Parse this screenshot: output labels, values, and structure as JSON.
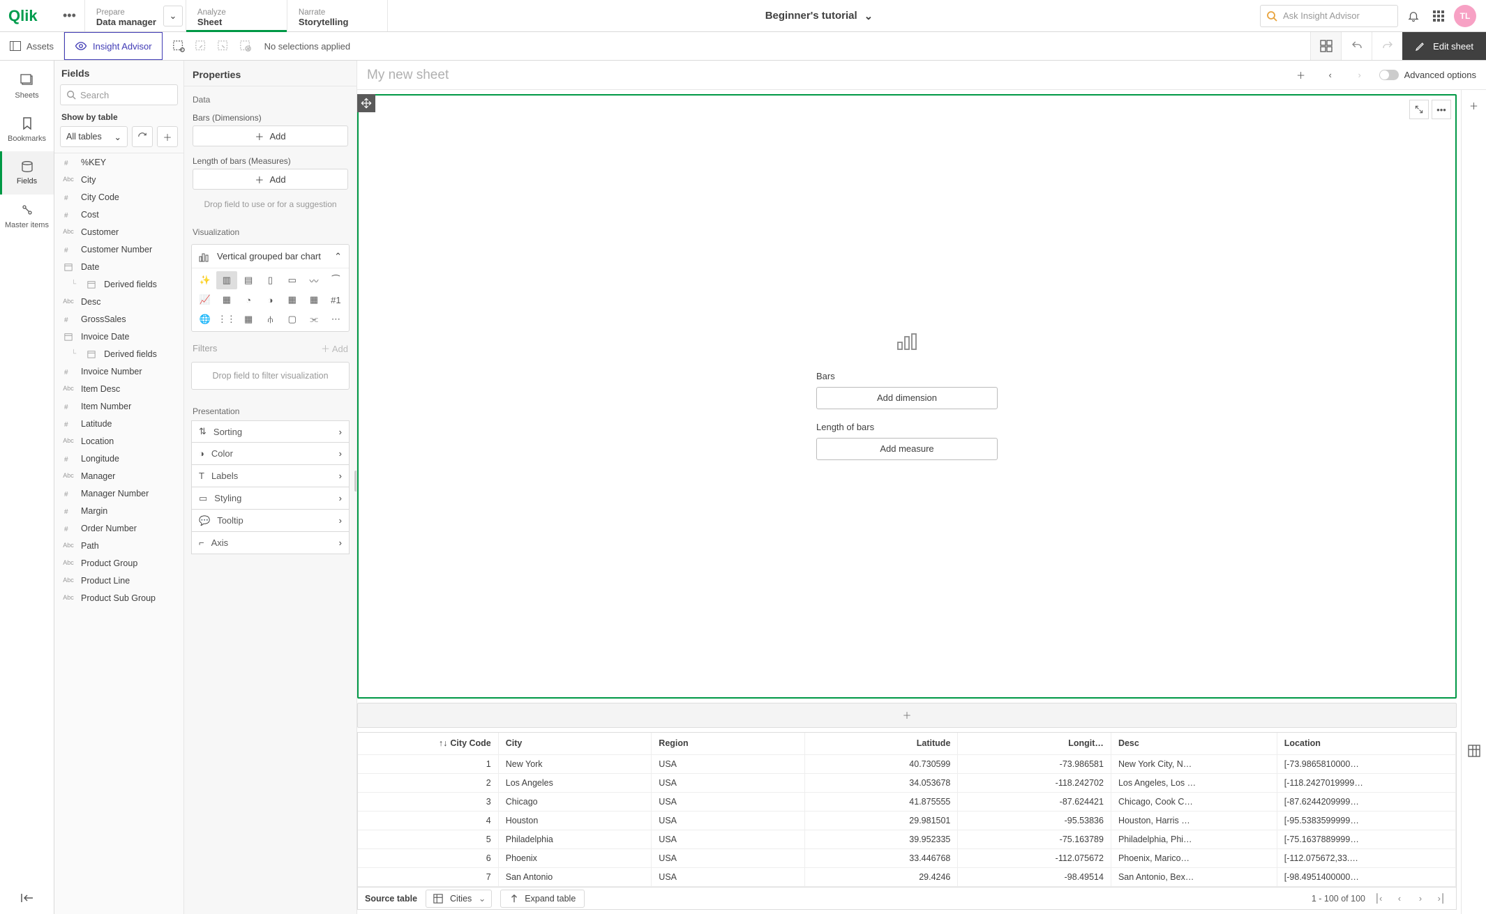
{
  "topbar": {
    "nav": [
      {
        "top": "Prepare",
        "bot": "Data manager",
        "dd": true
      },
      {
        "top": "Analyze",
        "bot": "Sheet",
        "active": true
      },
      {
        "top": "Narrate",
        "bot": "Storytelling"
      }
    ],
    "app_title": "Beginner's tutorial",
    "search_placeholder": "Ask Insight Advisor",
    "avatar": "TL"
  },
  "toolbar": {
    "assets": "Assets",
    "insight": "Insight Advisor",
    "no_sel": "No selections applied",
    "edit": "Edit sheet"
  },
  "rail": [
    {
      "id": "sheets",
      "label": "Sheets"
    },
    {
      "id": "bookmarks",
      "label": "Bookmarks"
    },
    {
      "id": "fields",
      "label": "Fields",
      "active": true
    },
    {
      "id": "master",
      "label": "Master items"
    }
  ],
  "fields_panel": {
    "title": "Fields",
    "search_ph": "Search",
    "show_by": "Show by table",
    "dd": "All tables",
    "items": [
      {
        "t": "num",
        "n": "%KEY"
      },
      {
        "t": "abc",
        "n": "City"
      },
      {
        "t": "num",
        "n": "City Code"
      },
      {
        "t": "num",
        "n": "Cost"
      },
      {
        "t": "abc",
        "n": "Customer"
      },
      {
        "t": "num",
        "n": "Customer Number"
      },
      {
        "t": "date",
        "n": "Date"
      },
      {
        "t": "der",
        "n": "Derived fields",
        "indent": true
      },
      {
        "t": "abc",
        "n": "Desc"
      },
      {
        "t": "num",
        "n": "GrossSales"
      },
      {
        "t": "date",
        "n": "Invoice Date"
      },
      {
        "t": "der",
        "n": "Derived fields",
        "indent": true
      },
      {
        "t": "num",
        "n": "Invoice Number"
      },
      {
        "t": "abc",
        "n": "Item Desc"
      },
      {
        "t": "num",
        "n": "Item Number"
      },
      {
        "t": "num",
        "n": "Latitude"
      },
      {
        "t": "abc",
        "n": "Location"
      },
      {
        "t": "num",
        "n": "Longitude"
      },
      {
        "t": "abc",
        "n": "Manager"
      },
      {
        "t": "num",
        "n": "Manager Number"
      },
      {
        "t": "num",
        "n": "Margin"
      },
      {
        "t": "num",
        "n": "Order Number"
      },
      {
        "t": "abc",
        "n": "Path"
      },
      {
        "t": "abc",
        "n": "Product Group"
      },
      {
        "t": "abc",
        "n": "Product Line"
      },
      {
        "t": "abc",
        "n": "Product Sub Group"
      }
    ]
  },
  "props": {
    "title": "Properties",
    "data": "Data",
    "bars": "Bars (Dimensions)",
    "length": "Length of bars (Measures)",
    "add": "Add",
    "drop": "Drop field to use or for a suggestion",
    "viz": "Visualization",
    "viz_sel": "Vertical grouped bar chart",
    "filters": "Filters",
    "filters_add": "Add",
    "filter_drop": "Drop field to filter visualization",
    "presentation": "Presentation",
    "pres_items": [
      "Sorting",
      "Color",
      "Labels",
      "Styling",
      "Tooltip",
      "Axis"
    ]
  },
  "canvas": {
    "sheet_title": "My new sheet",
    "adv": "Advanced options",
    "placeholder": {
      "bars": "Bars",
      "bars_btn": "Add dimension",
      "len": "Length of bars",
      "len_btn": "Add measure"
    }
  },
  "table": {
    "cols": [
      "City Code",
      "City",
      "Region",
      "Latitude",
      "Longit…",
      "Desc",
      "Location"
    ],
    "rows": [
      [
        "1",
        "New York",
        "USA",
        "40.730599",
        "-73.986581",
        "New York City, N…",
        "[-73.9865810000…"
      ],
      [
        "2",
        "Los Angeles",
        "USA",
        "34.053678",
        "-118.242702",
        "Los Angeles, Los …",
        "[-118.2427019999…"
      ],
      [
        "3",
        "Chicago",
        "USA",
        "41.875555",
        "-87.624421",
        "Chicago, Cook C…",
        "[-87.6244209999…"
      ],
      [
        "4",
        "Houston",
        "USA",
        "29.981501",
        "-95.53836",
        "Houston, Harris …",
        "[-95.5383599999…"
      ],
      [
        "5",
        "Philadelphia",
        "USA",
        "39.952335",
        "-75.163789",
        "Philadelphia, Phi…",
        "[-75.1637889999…"
      ],
      [
        "6",
        "Phoenix",
        "USA",
        "33.446768",
        "-112.075672",
        "Phoenix, Marico…",
        "[-112.075672,33.…"
      ],
      [
        "7",
        "San Antonio",
        "USA",
        "29.4246",
        "-98.49514",
        "San Antonio, Bex…",
        "[-98.4951400000…"
      ]
    ],
    "source_label": "Source table",
    "source_val": "Cities",
    "expand": "Expand table",
    "pager": "1 - 100 of 100"
  }
}
